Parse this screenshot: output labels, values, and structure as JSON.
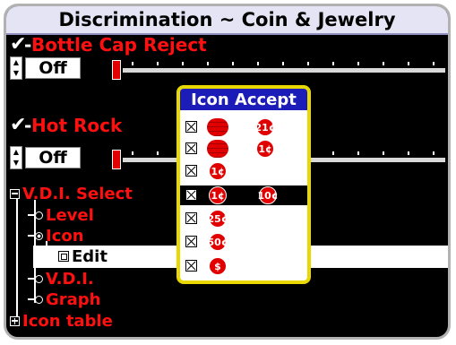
{
  "screen": {
    "title": "Discrimination ~ Coin & Jewelry"
  },
  "settings": {
    "bottle_cap": {
      "check": "✔",
      "label": "Bottle Cap Reject",
      "value": "Off"
    },
    "hot_rock": {
      "check": "✔",
      "label": "Hot Rock",
      "value": "Off"
    }
  },
  "tree": {
    "vdi_select": "V.D.I. Select",
    "level": "Level",
    "icon": "Icon",
    "edit": "Edit",
    "vdi": "V.D.I.",
    "graph": "Graph",
    "icon_table": "Icon table"
  },
  "popup": {
    "title": "Icon Accept",
    "rows": [
      {
        "checked": true,
        "icons": [
          "coin-stack",
          "21¢"
        ]
      },
      {
        "checked": true,
        "icons": [
          "coin-stack",
          "1¢"
        ]
      },
      {
        "checked": true,
        "icons": [
          "1¢"
        ]
      },
      {
        "checked": true,
        "icons": [
          "1¢",
          "10¢"
        ],
        "selected": true
      },
      {
        "checked": true,
        "icons": [
          "25¢"
        ]
      },
      {
        "checked": true,
        "icons": [
          "50¢"
        ]
      },
      {
        "checked": true,
        "icons": [
          "$"
        ]
      }
    ]
  },
  "colors": {
    "accent_red": "#ff1010",
    "popup_border": "#e8d800",
    "popup_title_bg": "#1c1cb8"
  }
}
